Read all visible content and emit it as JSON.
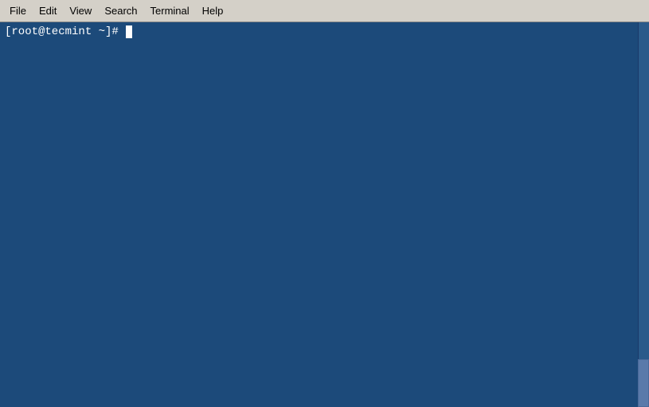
{
  "menubar": {
    "items": [
      {
        "id": "file",
        "label": "File"
      },
      {
        "id": "edit",
        "label": "Edit"
      },
      {
        "id": "view",
        "label": "View"
      },
      {
        "id": "search",
        "label": "Search"
      },
      {
        "id": "terminal",
        "label": "Terminal"
      },
      {
        "id": "help",
        "label": "Help"
      }
    ]
  },
  "terminal": {
    "prompt": "[root@tecmint ~]# "
  }
}
